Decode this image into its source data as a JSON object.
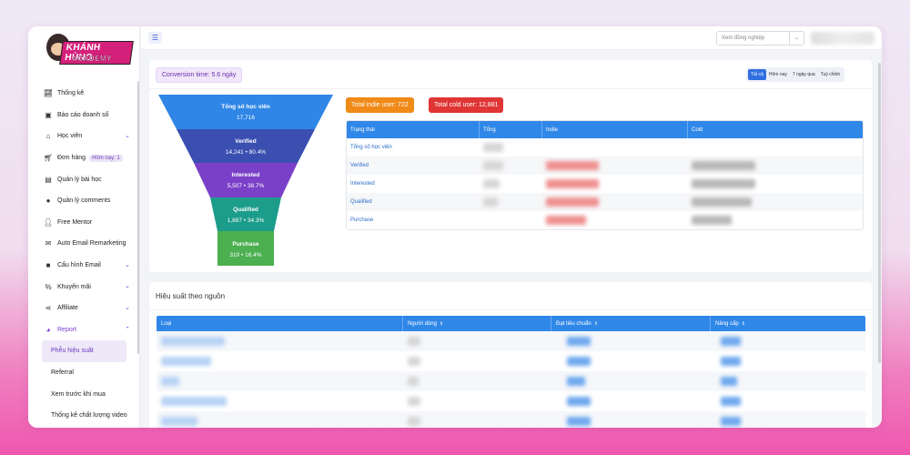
{
  "brand": {
    "logo_line1": "KHÁNH HÙNG",
    "logo_line2": "ACADEMY"
  },
  "sidebar": {
    "items": [
      {
        "label": "Thống kê",
        "icon": "chart-line-icon"
      },
      {
        "label": "Báo cáo doanh số",
        "icon": "briefcase-icon"
      },
      {
        "label": "Học viên",
        "icon": "graduation-cap-icon",
        "expandable": true
      },
      {
        "label": "Đơn hàng",
        "icon": "cart-icon",
        "badge": "Hôm nay: 1"
      },
      {
        "label": "Quản lý bài học",
        "icon": "book-icon"
      },
      {
        "label": "Quản lý comments",
        "icon": "comments-icon"
      },
      {
        "label": "Free Mentor",
        "icon": "user-icon"
      },
      {
        "label": "Auto Email Remarketing",
        "icon": "email-icon"
      },
      {
        "label": "Cấu hình Email",
        "icon": "video-icon",
        "expandable": true
      },
      {
        "label": "Khuyến mãi",
        "icon": "percent-icon",
        "expandable": true
      },
      {
        "label": "Affiliate",
        "icon": "share-icon",
        "expandable": true
      },
      {
        "label": "Report",
        "icon": "pie-chart-icon",
        "expanded": true
      }
    ],
    "report_children": [
      {
        "label": "Phễu hiệu suất",
        "active": true
      },
      {
        "label": "Referral"
      },
      {
        "label": "Xem trước khi mua"
      },
      {
        "label": "Thống kê chất lượng video"
      }
    ]
  },
  "topbar": {
    "colleague_select_placeholder": "Xem đồng nghiệp"
  },
  "funnel_panel": {
    "conversion_time": "Conversion time: 5.6 ngày",
    "range_buttons": [
      {
        "label": "Tất cả",
        "active": true
      },
      {
        "label": "Hôm nay"
      },
      {
        "label": "7 ngày qua"
      },
      {
        "label": "Tuỳ chỉnh"
      }
    ],
    "funnel": [
      {
        "label": "Tổng số học viên",
        "value": "17,716",
        "color": "#2f86e6"
      },
      {
        "label": "Verified",
        "value": "14,241 • 80.4%",
        "color": "#3a4fb0"
      },
      {
        "label": "Interested",
        "value": "5,507 • 38.7%",
        "color": "#7a40c7"
      },
      {
        "label": "Qualified",
        "value": "1,887 • 34.3%",
        "color": "#1c9c8a"
      },
      {
        "label": "Purchase",
        "value": "310 • 16.4%",
        "color": "#4caf50"
      }
    ],
    "total_indie": "Total indie user: 722",
    "total_cold": "Total cold user: 12,881",
    "table": {
      "headers": [
        "Trạng thái",
        "Tổng",
        "Indie",
        "Cold"
      ],
      "rows": [
        "Tổng số học viên",
        "Verified",
        "Interested",
        "Qualified",
        "Purchase"
      ]
    }
  },
  "source_panel": {
    "title": "Hiệu suất theo nguồn",
    "headers": [
      "Loại",
      "Người dùng",
      "Đạt tiêu chuẩn",
      "Nâng cấp"
    ]
  },
  "colors": {
    "accent": "#2f87e8",
    "purple": "#7b3fd0",
    "indie": "#f08a18",
    "cold": "#e03535"
  }
}
